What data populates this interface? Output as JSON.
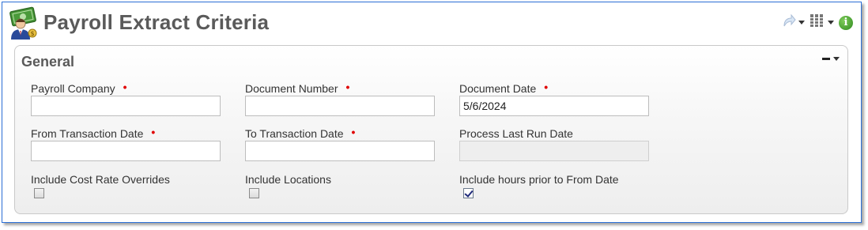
{
  "header": {
    "title": "Payroll Extract Criteria",
    "icon": "payroll-person-money-icon"
  },
  "toolbar": {
    "share_icon": "share-arrow-icon",
    "columns_icon": "columns-layout-icon",
    "info_icon": "info-icon",
    "info_glyph": "i"
  },
  "panel": {
    "title": "General",
    "collapse_icon": "minus-icon"
  },
  "fields": {
    "payroll_company": {
      "label": "Payroll Company",
      "required": "•",
      "value": ""
    },
    "document_number": {
      "label": "Document Number",
      "required": "•",
      "value": ""
    },
    "document_date": {
      "label": "Document Date",
      "required": "•",
      "value": "5/6/2024"
    },
    "from_transaction_date": {
      "label": "From Transaction Date",
      "required": "•",
      "value": ""
    },
    "to_transaction_date": {
      "label": "To Transaction Date",
      "required": "•",
      "value": ""
    },
    "process_last_run_date": {
      "label": "Process Last Run Date",
      "value": ""
    }
  },
  "checkboxes": {
    "include_cost_rate_overrides": {
      "label": "Include Cost Rate Overrides",
      "checked": false
    },
    "include_locations": {
      "label": "Include Locations",
      "checked": false
    },
    "include_hours_prior": {
      "label": "Include hours prior to From Date",
      "checked": true
    }
  },
  "colors": {
    "window_border": "#2b6fd6",
    "required_marker": "#e00000",
    "title_text": "#5a5a5a",
    "info_green": "#2f8a1f"
  }
}
